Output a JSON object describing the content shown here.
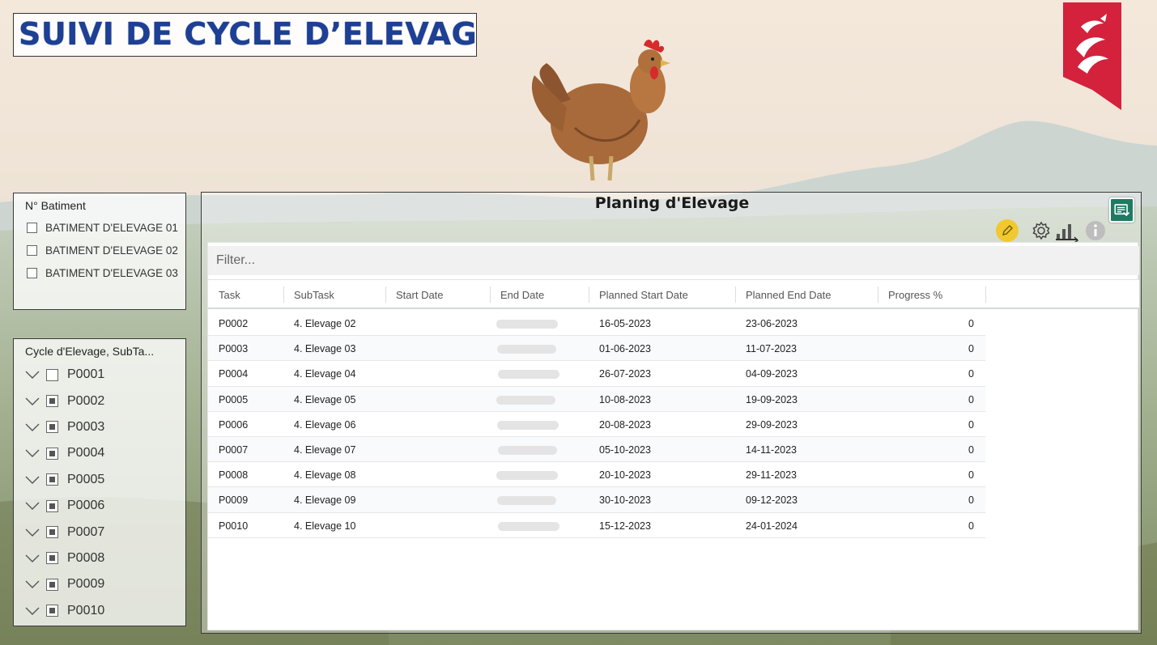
{
  "page": {
    "title": "SUIVI DE CYCLE D’ELEVAGE"
  },
  "batiment_slicer": {
    "title": "N° Batiment",
    "items": [
      {
        "label": "BATIMENT D'ELEVAGE 01",
        "checked": false
      },
      {
        "label": "BATIMENT D'ELEVAGE 02",
        "checked": false
      },
      {
        "label": "BATIMENT D'ELEVAGE 03",
        "checked": false
      }
    ]
  },
  "cycle_slicer": {
    "title": "Cycle d'Elevage, SubTa...",
    "items": [
      {
        "label": "P0001",
        "checked": false
      },
      {
        "label": "P0002",
        "checked": true
      },
      {
        "label": "P0003",
        "checked": true
      },
      {
        "label": "P0004",
        "checked": true
      },
      {
        "label": "P0005",
        "checked": true
      },
      {
        "label": "P0006",
        "checked": true
      },
      {
        "label": "P0007",
        "checked": true
      },
      {
        "label": "P0008",
        "checked": true
      },
      {
        "label": "P0009",
        "checked": true
      },
      {
        "label": "P0010",
        "checked": true
      }
    ]
  },
  "planning": {
    "title": "Planing d'Elevage",
    "filter_placeholder": "Filter...",
    "toolbar": {
      "export_icon": "export-icon",
      "edit_icon": "pencil-icon",
      "settings_icon": "gear-icon",
      "chart_icon": "bar-chart-icon",
      "info_icon": "info-icon"
    },
    "columns": [
      "Task",
      "SubTask",
      "Start Date",
      "End Date",
      "Planned Start Date",
      "Planned End Date",
      "Progress %"
    ],
    "rows": [
      {
        "task": "P0002",
        "subtask": "4. Elevage 02",
        "start": "",
        "planned_start": "16-05-2023",
        "planned_end": "23-06-2023",
        "progress": "0"
      },
      {
        "task": "P0003",
        "subtask": "4. Elevage 03",
        "start": "",
        "planned_start": "01-06-2023",
        "planned_end": "11-07-2023",
        "progress": "0"
      },
      {
        "task": "P0004",
        "subtask": "4. Elevage 04",
        "start": "",
        "planned_start": "26-07-2023",
        "planned_end": "04-09-2023",
        "progress": "0"
      },
      {
        "task": "P0005",
        "subtask": "4. Elevage 05",
        "start": "",
        "planned_start": "10-08-2023",
        "planned_end": "19-09-2023",
        "progress": "0"
      },
      {
        "task": "P0006",
        "subtask": "4. Elevage 06",
        "start": "",
        "planned_start": "20-08-2023",
        "planned_end": "29-09-2023",
        "progress": "0"
      },
      {
        "task": "P0007",
        "subtask": "4. Elevage 07",
        "start": "",
        "planned_start": "05-10-2023",
        "planned_end": "14-11-2023",
        "progress": "0"
      },
      {
        "task": "P0008",
        "subtask": "4. Elevage 08",
        "start": "",
        "planned_start": "20-10-2023",
        "planned_end": "29-11-2023",
        "progress": "0"
      },
      {
        "task": "P0009",
        "subtask": "4. Elevage 09",
        "start": "",
        "planned_start": "30-10-2023",
        "planned_end": "09-12-2023",
        "progress": "0"
      },
      {
        "task": "P0010",
        "subtask": "4. Elevage 10",
        "start": "",
        "planned_start": "15-12-2023",
        "planned_end": "24-01-2024",
        "progress": "0"
      }
    ]
  },
  "colors": {
    "title_blue": "#1d3f94",
    "logo_red": "#d4213c",
    "export_green": "#1f7a63",
    "edit_yellow": "#f2c830"
  }
}
